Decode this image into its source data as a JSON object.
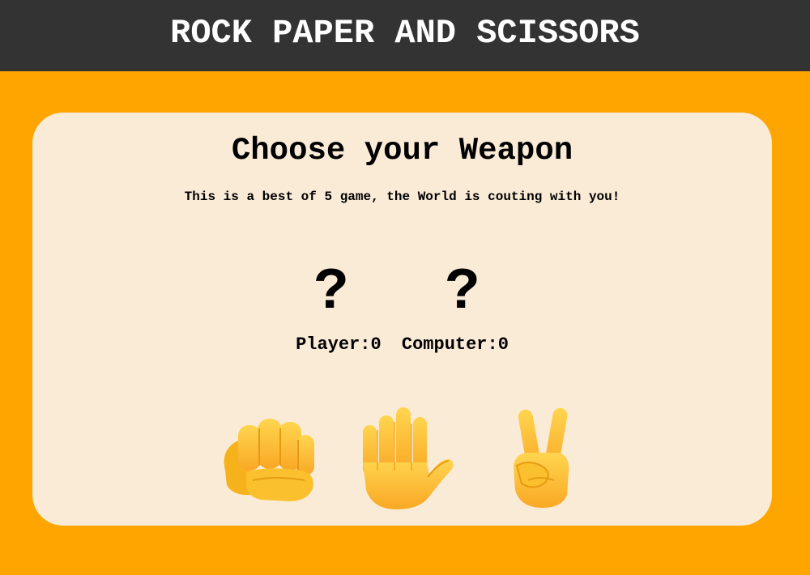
{
  "header": {
    "title": "ROCK PAPER AND SCISSORS"
  },
  "card": {
    "title": "Choose your Weapon",
    "subtitle": "This is a best of 5 game, the World is couting with you!"
  },
  "round": {
    "player_sign": "?",
    "computer_sign": "?"
  },
  "score": {
    "player_label": "Player:",
    "player_value": "0",
    "computer_label": "Computer:",
    "computer_value": "0"
  },
  "weapons": [
    {
      "name": "rock",
      "icon": "raised-fist-icon"
    },
    {
      "name": "paper",
      "icon": "raised-hand-icon"
    },
    {
      "name": "scissors",
      "icon": "victory-hand-icon"
    }
  ],
  "colors": {
    "background": "#ffa500",
    "header": "#333333",
    "card": "#faebd7",
    "emoji_skin": "#fbc02d"
  }
}
